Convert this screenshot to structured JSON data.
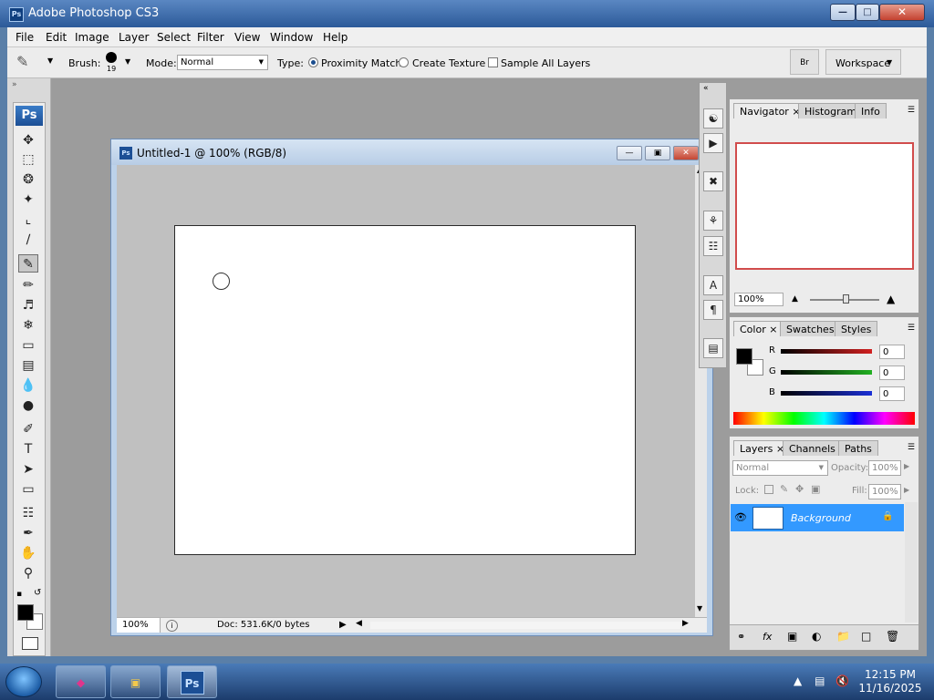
{
  "window": {
    "title": "Adobe Photoshop CS3",
    "app_icon": "Ps"
  },
  "menubar": [
    "File",
    "Edit",
    "Image",
    "Layer",
    "Select",
    "Filter",
    "View",
    "Window",
    "Help"
  ],
  "options": {
    "brush_label": "Brush:",
    "brush_size": "19",
    "mode_label": "Mode:",
    "mode_value": "Normal",
    "type_label": "Type:",
    "proximity_match": "Proximity Match",
    "create_texture": "Create Texture",
    "sample_all_layers": "Sample All Layers",
    "workspace": "Workspace"
  },
  "toolbox": {
    "logo": "Ps",
    "tools": [
      "move-tool-icon",
      "marquee-tool-icon",
      "lasso-tool-icon",
      "magic-wand-icon",
      "crop-tool-icon",
      "slice-tool-icon",
      "spot-healing-brush-icon",
      "brush-tool-icon",
      "clone-stamp-icon",
      "history-brush-icon",
      "eraser-icon",
      "gradient-icon",
      "blur-icon",
      "dodge-icon",
      "pen-tool-icon",
      "type-tool-icon",
      "path-selection-icon",
      "rectangle-tool-icon",
      "notes-icon",
      "eyedropper-icon",
      "hand-tool-icon",
      "zoom-tool-icon"
    ]
  },
  "document": {
    "title": "Untitled-1 @ 100% (RGB/8)",
    "zoom": "100%",
    "doc_info": "Doc: 531.6K/0 bytes"
  },
  "navigator": {
    "tabs": [
      "Navigator",
      "Histogram",
      "Info"
    ],
    "zoom": "100%"
  },
  "color_panel": {
    "tabs": [
      "Color",
      "Swatches",
      "Styles"
    ],
    "channels": [
      {
        "label": "R",
        "value": "0",
        "color": "#d12020"
      },
      {
        "label": "G",
        "value": "0",
        "color": "#22b022"
      },
      {
        "label": "B",
        "value": "0",
        "color": "#1a2fd6"
      }
    ]
  },
  "layers_panel": {
    "tabs": [
      "Layers",
      "Channels",
      "Paths"
    ],
    "blend_mode": "Normal",
    "opacity_label": "Opacity:",
    "opacity": "100%",
    "lock_label": "Lock:",
    "fill_label": "Fill:",
    "fill": "100%",
    "layer_name": "Background"
  },
  "taskbar": {
    "time": "12:15 PM",
    "date": "11/16/2025",
    "ps_label": "Ps"
  }
}
